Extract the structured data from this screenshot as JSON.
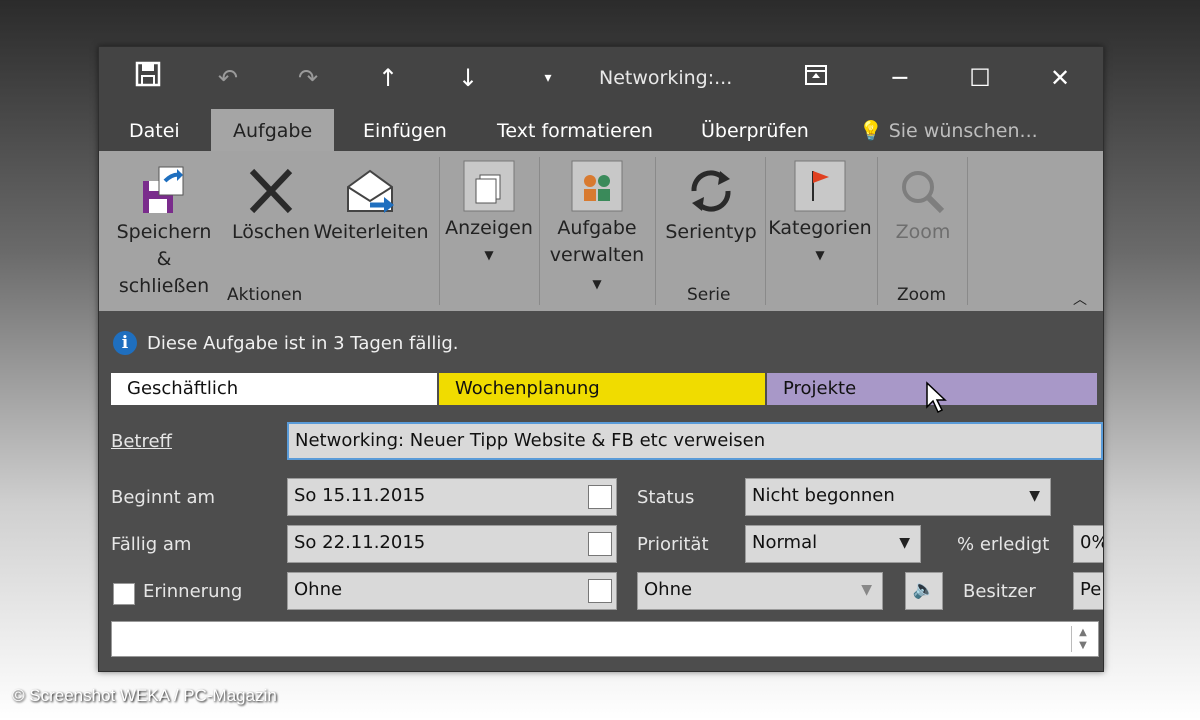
{
  "window": {
    "title": "Networking:...",
    "title_icons": [
      "save-icon",
      "undo-icon",
      "redo-icon",
      "arrow-up-icon",
      "arrow-down-icon",
      "customize-icon"
    ],
    "tabs": [
      "Datei",
      "Aufgabe",
      "Einfügen",
      "Text formatieren",
      "Überprüfen"
    ],
    "active_tab": "Aufgabe",
    "tell_me": "Sie wünschen..."
  },
  "ribbon": {
    "save_close": [
      "Speichern",
      "& schließen"
    ],
    "delete": "Löschen",
    "forward": "Weiterleiten",
    "group_actions": "Aktionen",
    "show": "Anzeigen",
    "manage": [
      "Aufgabe",
      "verwalten"
    ],
    "recurrence": "Serientyp",
    "group_series": "Serie",
    "categories": "Kategorien",
    "zoom": "Zoom",
    "group_zoom": "Zoom"
  },
  "info": "Diese Aufgabe ist in 3 Tagen fällig.",
  "categories": [
    {
      "label": "Geschäftlich",
      "color": "#ffffff"
    },
    {
      "label": "Wochenplanung",
      "color": "#f0dc00"
    },
    {
      "label": "Projekte",
      "color": "#a898c8"
    }
  ],
  "form": {
    "subject_label": "Betreff",
    "subject_value": "Networking: Neuer Tipp Website & FB etc verweisen",
    "start_label": "Beginnt am",
    "start_value": "So 15.11.2015",
    "due_label": "Fällig am",
    "due_value": "So 22.11.2015",
    "reminder_label": "Erinnerung",
    "reminder_value": "Ohne",
    "reminder_time": "Ohne",
    "status_label": "Status",
    "status_value": "Nicht begonnen",
    "priority_label": "Priorität",
    "priority_value": "Normal",
    "percent_label": "% erledigt",
    "percent_value": "0%",
    "owner_label": "Besitzer",
    "owner_value": "Pe"
  },
  "watermark": "© Screenshot WEKA / PC-Magazin"
}
